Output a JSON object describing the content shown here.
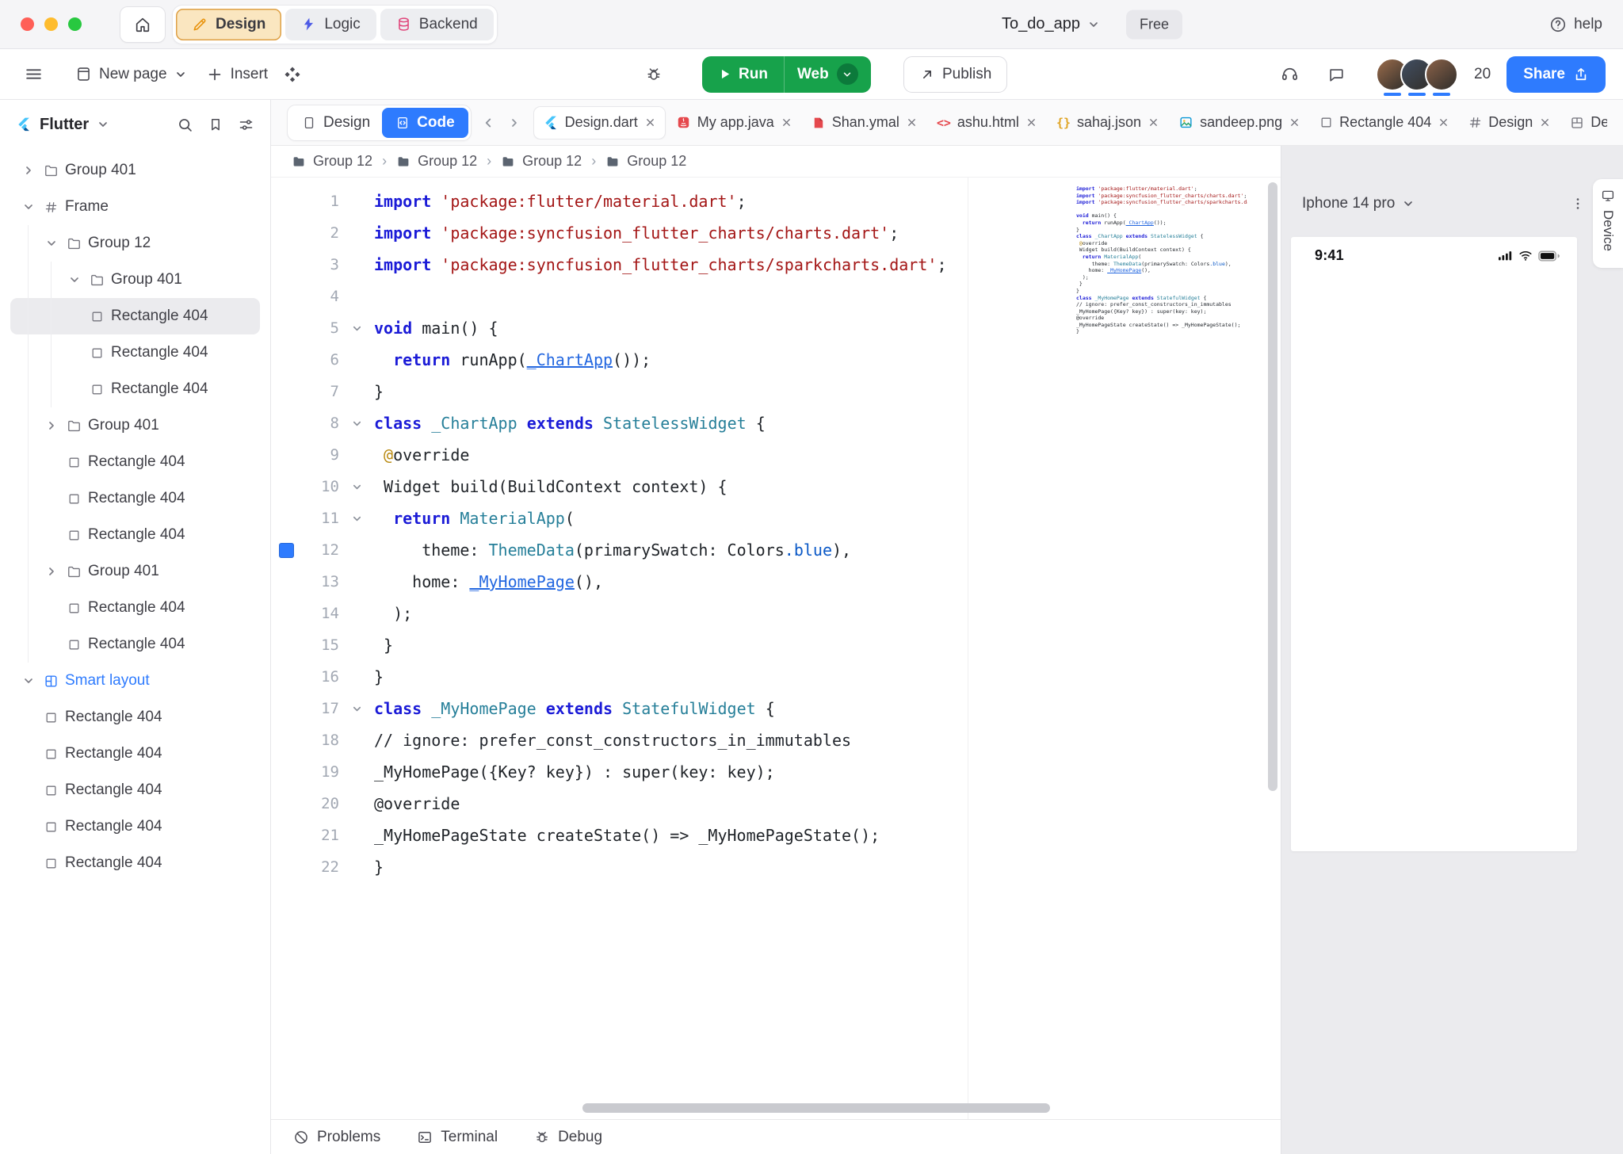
{
  "titlebar": {
    "project_name": "To_do_app",
    "plan_badge": "Free",
    "help_label": "help",
    "mode_tabs": [
      {
        "label": "Design",
        "icon": "design",
        "active": true
      },
      {
        "label": "Logic",
        "icon": "logic",
        "active": false
      },
      {
        "label": "Backend",
        "icon": "backend",
        "active": false
      }
    ]
  },
  "toolbar": {
    "new_page_label": "New page",
    "insert_label": "Insert",
    "run_label": "Run",
    "web_label": "Web",
    "publish_label": "Publish",
    "collaborator_count": "20",
    "share_label": "Share",
    "avatar_colors": [
      "#8a6246",
      "#3f4a5a",
      "#7d5a44"
    ]
  },
  "sidebar": {
    "framework_label": "Flutter",
    "layers": [
      {
        "label": "Group 401",
        "icon": "folder",
        "chevron": "right",
        "indent": 0
      },
      {
        "label": "Frame",
        "icon": "hash",
        "chevron": "down",
        "indent": 0
      },
      {
        "label": "Group 12",
        "icon": "folder",
        "chevron": "down",
        "indent": 1
      },
      {
        "label": "Group 401",
        "icon": "folder",
        "chevron": "down",
        "indent": 2
      },
      {
        "label": "Rectangle 404",
        "icon": "square",
        "indent": 2,
        "selected": true
      },
      {
        "label": "Rectangle 404",
        "icon": "square",
        "indent": 2
      },
      {
        "label": "Rectangle 404",
        "icon": "square",
        "indent": 2
      },
      {
        "label": "Group 401",
        "icon": "folder",
        "chevron": "right",
        "indent": 1
      },
      {
        "label": "Rectangle 404",
        "icon": "square",
        "indent": 1
      },
      {
        "label": "Rectangle 404",
        "icon": "square",
        "indent": 1
      },
      {
        "label": "Rectangle 404",
        "icon": "square",
        "indent": 1
      },
      {
        "label": "Group 401",
        "icon": "folder",
        "chevron": "right",
        "indent": 1
      },
      {
        "label": "Rectangle 404",
        "icon": "square",
        "indent": 1
      },
      {
        "label": "Rectangle 404",
        "icon": "square",
        "indent": 1
      },
      {
        "label": "Smart layout",
        "icon": "smart",
        "chevron": "down",
        "indent": 0,
        "accent": true
      },
      {
        "label": "Rectangle 404",
        "icon": "square",
        "indent": 0
      },
      {
        "label": "Rectangle 404",
        "icon": "square",
        "indent": 0
      },
      {
        "label": "Rectangle 404",
        "icon": "square",
        "indent": 0
      },
      {
        "label": "Rectangle 404",
        "icon": "square",
        "indent": 0
      },
      {
        "label": "Rectangle 404",
        "icon": "square",
        "indent": 0
      }
    ]
  },
  "editor": {
    "design_view_label": "Design",
    "code_view_label": "Code",
    "file_tabs": [
      {
        "name": "Design.dart",
        "icon": "flutter",
        "active": true
      },
      {
        "name": "My app.java",
        "icon": "java"
      },
      {
        "name": "Shan.ymal",
        "icon": "yaml"
      },
      {
        "name": "ashu.html",
        "icon": "html"
      },
      {
        "name": "sahaj.json",
        "icon": "json"
      },
      {
        "name": "sandeep.png",
        "icon": "image"
      },
      {
        "name": "Rectangle 404",
        "icon": "square"
      },
      {
        "name": "Design",
        "icon": "hash"
      },
      {
        "name": "Design",
        "icon": "grid"
      }
    ],
    "breadcrumb": [
      "Group 12",
      "Group 12",
      "Group 12",
      "Group 12"
    ],
    "bottom_tabs": [
      {
        "label": "Problems",
        "icon": "problems"
      },
      {
        "label": "Terminal",
        "icon": "terminal"
      },
      {
        "label": "Debug",
        "icon": "debug"
      }
    ],
    "code_lines": [
      {
        "num": 1,
        "tokens": [
          [
            "kw",
            "import"
          ],
          [
            "pl",
            " "
          ],
          [
            "str",
            "'package:flutter/material.dart'"
          ],
          [
            "pl",
            ";"
          ]
        ]
      },
      {
        "num": 2,
        "tokens": [
          [
            "kw",
            "import"
          ],
          [
            "pl",
            " "
          ],
          [
            "str",
            "'package:syncfusion_flutter_charts/charts.dart'"
          ],
          [
            "pl",
            ";"
          ]
        ]
      },
      {
        "num": 3,
        "tokens": [
          [
            "kw",
            "import"
          ],
          [
            "pl",
            " "
          ],
          [
            "str",
            "'package:syncfusion_flutter_charts/sparkcharts.dart'"
          ],
          [
            "pl",
            ";"
          ]
        ]
      },
      {
        "num": 4,
        "tokens": []
      },
      {
        "num": 5,
        "fold": true,
        "tokens": [
          [
            "kw",
            "void"
          ],
          [
            "pl",
            " main() {"
          ]
        ]
      },
      {
        "num": 6,
        "indent": 2,
        "tokens": [
          [
            "kw",
            "return"
          ],
          [
            "pl",
            " runApp("
          ],
          [
            "link",
            "_ChartApp"
          ],
          [
            "pl",
            "());"
          ]
        ]
      },
      {
        "num": 7,
        "tokens": [
          [
            "pl",
            "}"
          ]
        ]
      },
      {
        "num": 8,
        "fold": true,
        "tokens": [
          [
            "kw",
            "class"
          ],
          [
            "pl",
            " "
          ],
          [
            "type",
            "_ChartApp"
          ],
          [
            "pl",
            " "
          ],
          [
            "kw",
            "extends"
          ],
          [
            "pl",
            " "
          ],
          [
            "type",
            "StatelessWidget"
          ],
          [
            "pl",
            " {"
          ]
        ]
      },
      {
        "num": 9,
        "indent": 1,
        "tokens": [
          [
            "at",
            "@"
          ],
          [
            "pl",
            "override"
          ]
        ]
      },
      {
        "num": 10,
        "indent": 1,
        "fold": true,
        "tokens": [
          [
            "pl",
            "Widget build(BuildContext context) {"
          ]
        ]
      },
      {
        "num": 11,
        "indent": 2,
        "fold": true,
        "tokens": [
          [
            "kw",
            "return"
          ],
          [
            "pl",
            " "
          ],
          [
            "type",
            "MaterialApp"
          ],
          [
            "pl",
            "("
          ]
        ]
      },
      {
        "num": 12,
        "indent": 5,
        "marker": true,
        "tokens": [
          [
            "pl",
            "theme: "
          ],
          [
            "type",
            "ThemeData"
          ],
          [
            "pl",
            "(primarySwatch: Colors"
          ],
          [
            "mem",
            ".blue"
          ],
          [
            "pl",
            "),"
          ]
        ]
      },
      {
        "num": 13,
        "indent": 4,
        "tokens": [
          [
            "pl",
            "home: "
          ],
          [
            "link",
            "_MyHomePage"
          ],
          [
            "pl",
            "(),"
          ]
        ]
      },
      {
        "num": 14,
        "indent": 2,
        "tokens": [
          [
            "pl",
            ");"
          ]
        ]
      },
      {
        "num": 15,
        "indent": 1,
        "tokens": [
          [
            "pl",
            "}"
          ]
        ]
      },
      {
        "num": 16,
        "tokens": [
          [
            "pl",
            "}"
          ]
        ]
      },
      {
        "num": 17,
        "fold": true,
        "tokens": [
          [
            "kw",
            "class"
          ],
          [
            "pl",
            " "
          ],
          [
            "type",
            "_MyHomePage"
          ],
          [
            "pl",
            " "
          ],
          [
            "kw",
            "extends"
          ],
          [
            "pl",
            " "
          ],
          [
            "type",
            "StatefulWidget"
          ],
          [
            "pl",
            " {"
          ]
        ]
      },
      {
        "num": 18,
        "tokens": [
          [
            "cm",
            "// ignore: prefer_const_constructors_in_immutables"
          ]
        ]
      },
      {
        "num": 19,
        "tokens": [
          [
            "pl",
            "_MyHomePage({Key? key}) : super(key: key);"
          ]
        ]
      },
      {
        "num": 20,
        "tokens": [
          [
            "pl",
            "@override"
          ]
        ]
      },
      {
        "num": 21,
        "tokens": [
          [
            "pl",
            "_MyHomePageState createState() => _MyHomePageState();"
          ]
        ]
      },
      {
        "num": 22,
        "tokens": [
          [
            "pl",
            "}"
          ]
        ]
      }
    ]
  },
  "preview": {
    "device_name": "Iphone 14 pro",
    "status_time": "9:41",
    "device_tab_label": "Device"
  },
  "colors": {
    "accent_blue": "#2e7bfe",
    "run_green": "#17a24b",
    "design_tab_bg": "#fae6c0",
    "design_tab_border": "#dfa147"
  }
}
